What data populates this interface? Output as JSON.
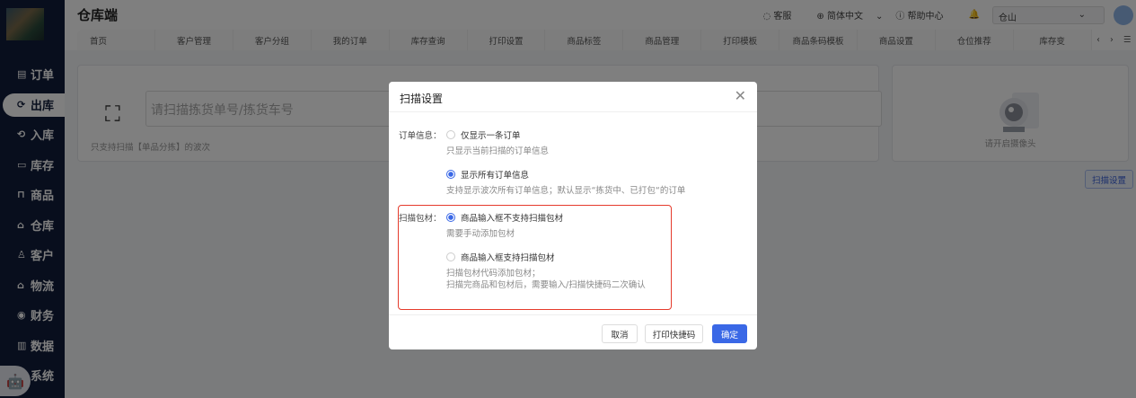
{
  "app": {
    "title": "仓库端"
  },
  "sidebar": {
    "items": [
      {
        "label": "订单",
        "icon": "▤"
      },
      {
        "label": "出库",
        "icon": "⟳",
        "active": true
      },
      {
        "label": "入库",
        "icon": "⟲"
      },
      {
        "label": "库存",
        "icon": "▭"
      },
      {
        "label": "商品",
        "icon": "⊓"
      },
      {
        "label": "仓库",
        "icon": "⌂"
      },
      {
        "label": "客户",
        "icon": "♙"
      },
      {
        "label": "物流",
        "icon": "⌂"
      },
      {
        "label": "财务",
        "icon": "◉"
      },
      {
        "label": "数据",
        "icon": "▥"
      },
      {
        "label": "系统",
        "icon": ""
      }
    ]
  },
  "topbar": {
    "service": "客服",
    "language": "简体中文",
    "help": "帮助中心",
    "warehouse": "仓山"
  },
  "tabs": [
    "首页",
    "客户管理",
    "客户分组",
    "我的订单",
    "库存查询",
    "打印设置",
    "商品标签",
    "商品管理",
    "打印模板",
    "商品条码模板",
    "商品设置",
    "仓位推荐",
    "库存变"
  ],
  "main": {
    "scan_placeholder": "请扫描拣货单号/拣货车号",
    "scan_hint": "只支持扫描【单品分拣】的波次",
    "camera_text": "请开启摄像头",
    "scan_settings_button": "扫描设置"
  },
  "modal": {
    "title": "扫描设置",
    "order_info_label": "订单信息：",
    "order_options": [
      {
        "label": "仅显示一条订单",
        "desc": "只显示当前扫描的订单信息",
        "selected": false
      },
      {
        "label": "显示所有订单信息",
        "desc": "支持显示波次所有订单信息；默认显示“拣货中、已打包“的订单",
        "selected": true
      }
    ],
    "packing_label": "扫描包材：",
    "packing_options": [
      {
        "label": "商品输入框不支持扫描包材",
        "desc": "需要手动添加包材",
        "selected": true
      },
      {
        "label": "商品输入框支持扫描包材",
        "desc": "扫描包材代码添加包材；",
        "desc2": "扫描完商品和包材后，需要输入/扫描快捷码二次确认",
        "selected": false
      }
    ],
    "cancel": "取消",
    "print_shortcut": "打印快捷码",
    "confirm": "确定"
  },
  "colors": {
    "sidebar": "#111d3a",
    "primary": "#3a68e6",
    "highlight": "#e53b2c"
  }
}
